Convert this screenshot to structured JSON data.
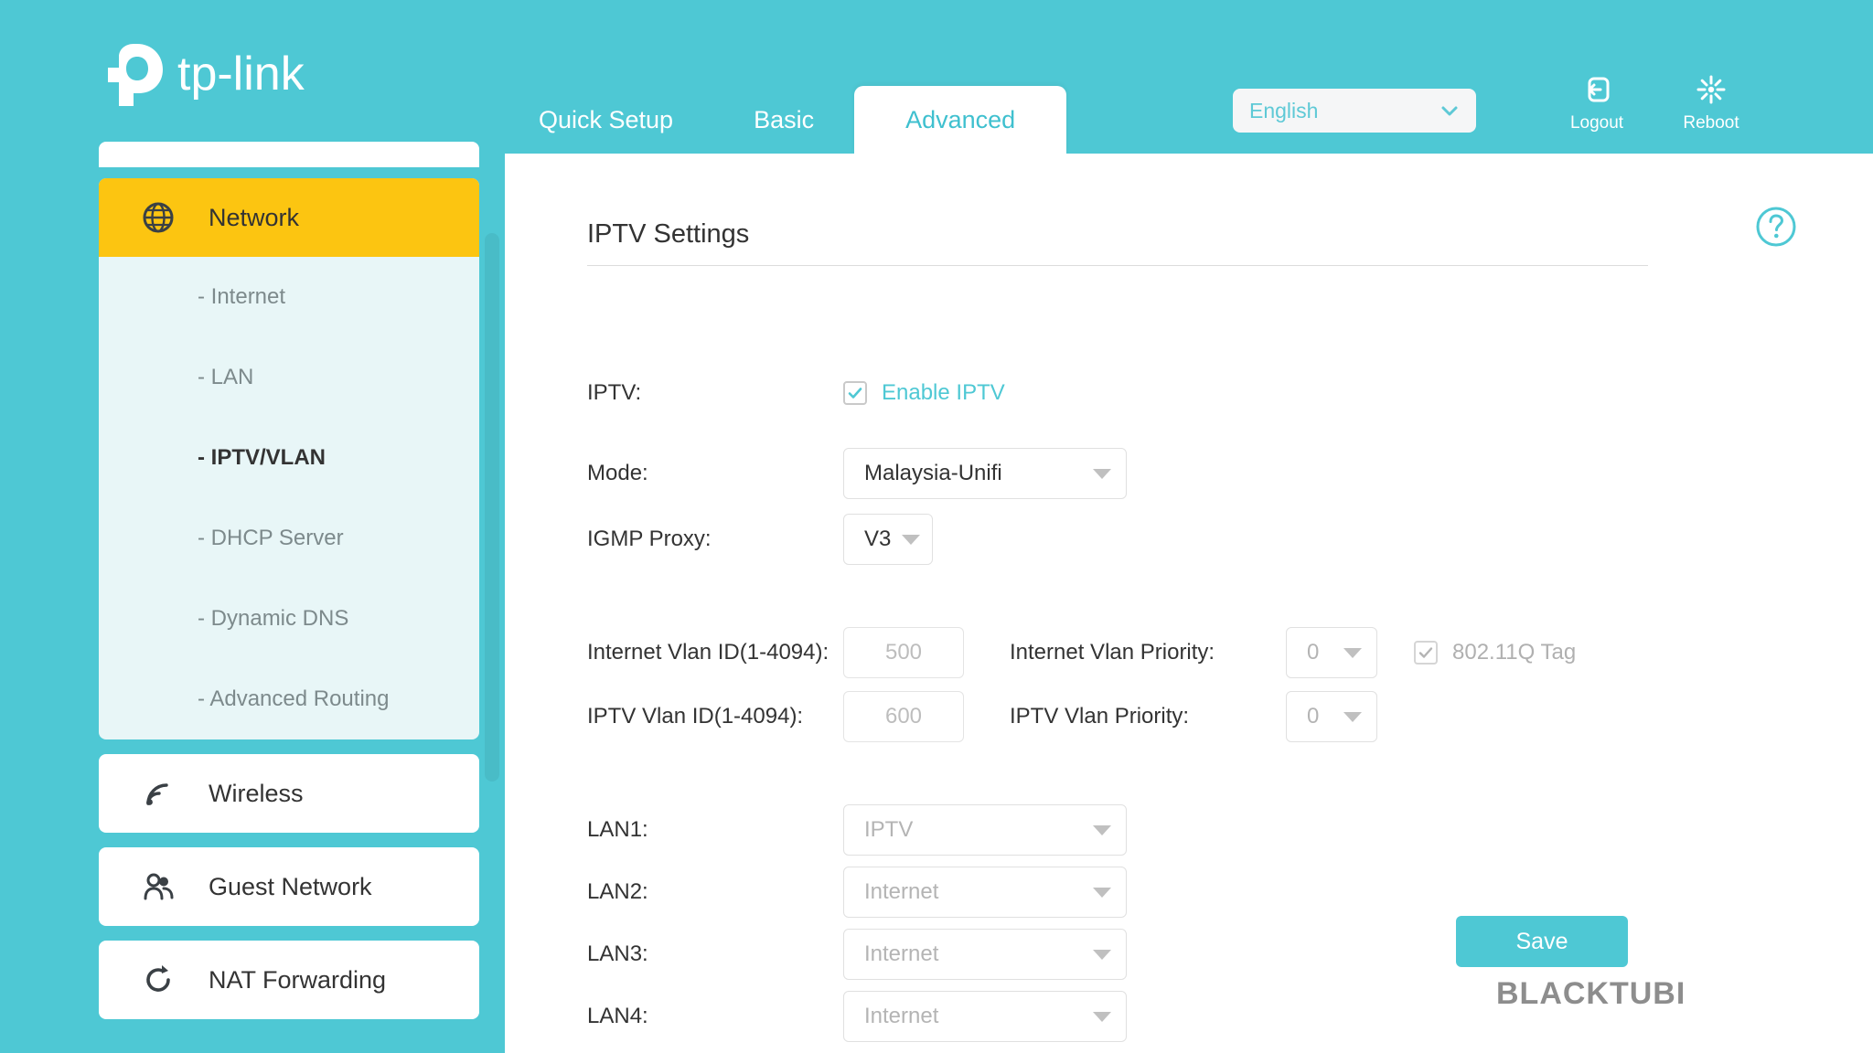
{
  "brand": {
    "name": "tp-link"
  },
  "topnav": {
    "tabs": [
      {
        "label": "Quick Setup",
        "active": false
      },
      {
        "label": "Basic",
        "active": false
      },
      {
        "label": "Advanced",
        "active": true
      }
    ],
    "language": {
      "value": "English",
      "icon": "chevron-down-icon"
    },
    "logout": {
      "label": "Logout",
      "icon": "logout-icon"
    },
    "reboot": {
      "label": "Reboot",
      "icon": "reboot-icon"
    }
  },
  "sidebar": {
    "group": {
      "label": "Network",
      "icon": "globe-icon",
      "items": [
        {
          "label": "- Internet",
          "active": false
        },
        {
          "label": "- LAN",
          "active": false
        },
        {
          "label": "- IPTV/VLAN",
          "active": true
        },
        {
          "label": "- DHCP Server",
          "active": false
        },
        {
          "label": "- Dynamic DNS",
          "active": false
        },
        {
          "label": "- Advanced Routing",
          "active": false
        }
      ]
    },
    "items": [
      {
        "label": "Wireless",
        "icon": "wifi-icon"
      },
      {
        "label": "Guest Network",
        "icon": "people-icon"
      },
      {
        "label": "NAT Forwarding",
        "icon": "refresh-icon"
      }
    ]
  },
  "panel": {
    "title": "IPTV Settings",
    "help_icon": "question-circle-icon",
    "iptv": {
      "label": "IPTV:",
      "checkbox_label": "Enable IPTV",
      "checked": true
    },
    "mode": {
      "label": "Mode:",
      "value": "Malaysia-Unifi"
    },
    "igmp_proxy": {
      "label": "IGMP Proxy:",
      "value": "V3"
    },
    "vlan_rows": [
      {
        "id_label": "Internet Vlan ID(1-4094):",
        "id_value": "500",
        "priority_label": "Internet Vlan Priority:",
        "priority_value": "0",
        "tag_label": "802.11Q Tag",
        "tag_checked": true
      },
      {
        "id_label": "IPTV Vlan ID(1-4094):",
        "id_value": "600",
        "priority_label": "IPTV Vlan Priority:",
        "priority_value": "0"
      }
    ],
    "lan_ports": [
      {
        "label": "LAN1:",
        "value": "IPTV"
      },
      {
        "label": "LAN2:",
        "value": "Internet"
      },
      {
        "label": "LAN3:",
        "value": "Internet"
      },
      {
        "label": "LAN4:",
        "value": "Internet"
      }
    ],
    "save_label": "Save"
  },
  "watermark": "BLACKTUBI",
  "colors": {
    "brand_teal": "#4ec8d4",
    "accent_yellow": "#fcc511",
    "sub_panel": "#e8f6f7"
  }
}
